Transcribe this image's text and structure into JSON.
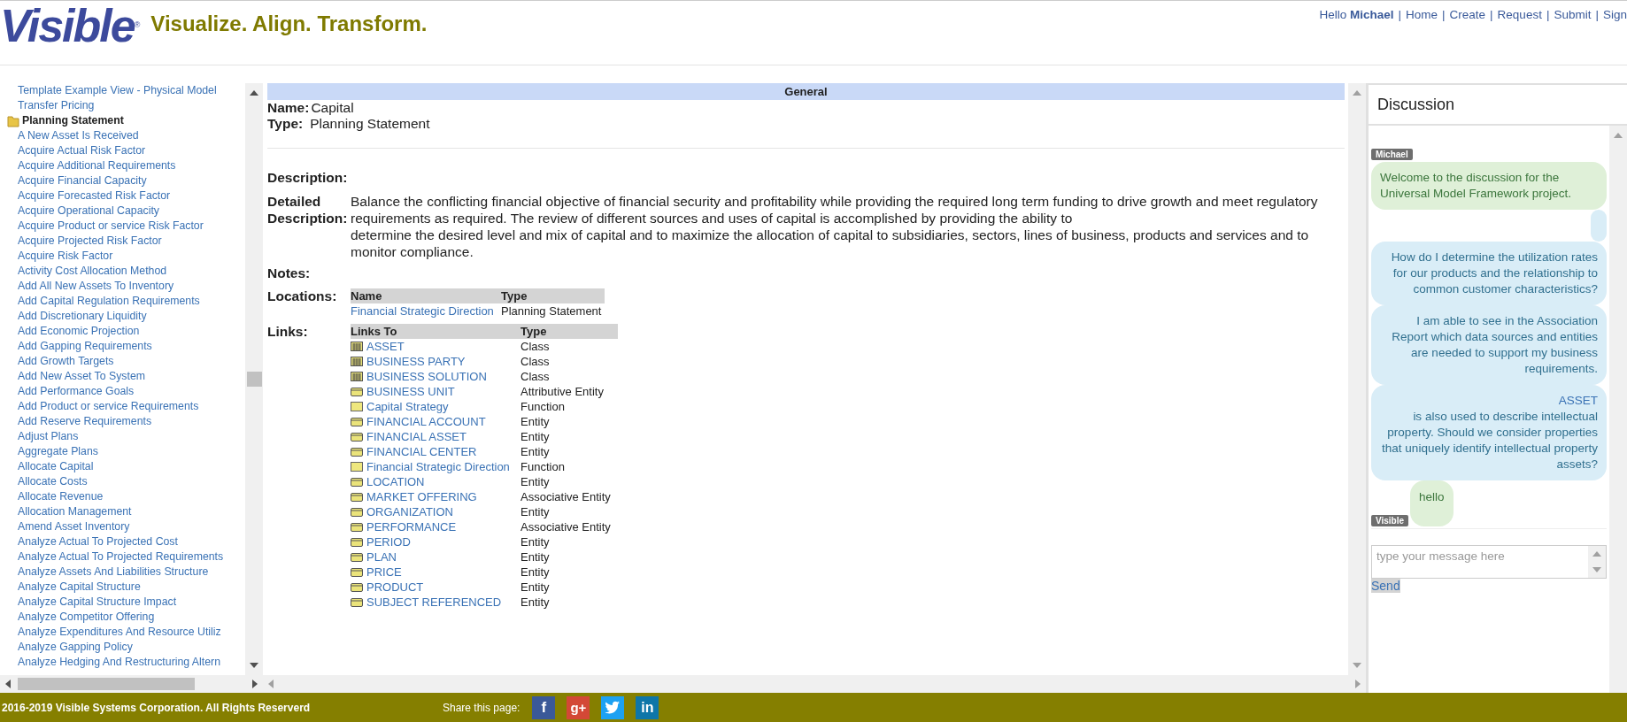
{
  "header": {
    "logo": "Visible",
    "logo_mark": "®",
    "tagline": "Visualize. Align. Transform.",
    "greeting": "Hello **Michael**",
    "separator": "|",
    "nav": [
      "Home",
      "Create",
      "Request",
      "Submit",
      "Sign"
    ]
  },
  "sidebar": {
    "items": [
      {
        "kind": "link",
        "label": "Template Example View - Physical Model"
      },
      {
        "kind": "link",
        "label": "Transfer Pricing"
      },
      {
        "kind": "folder",
        "label": "Planning Statement"
      },
      {
        "kind": "link",
        "label": "A New Asset Is Received"
      },
      {
        "kind": "link",
        "label": "Acquire Actual Risk Factor"
      },
      {
        "kind": "link",
        "label": "Acquire Additional Requirements"
      },
      {
        "kind": "link",
        "label": "Acquire Financial Capacity"
      },
      {
        "kind": "link",
        "label": "Acquire Forecasted Risk Factor"
      },
      {
        "kind": "link",
        "label": "Acquire Operational Capacity"
      },
      {
        "kind": "link",
        "label": "Acquire Product or service Risk Factor"
      },
      {
        "kind": "link",
        "label": "Acquire Projected Risk Factor"
      },
      {
        "kind": "link",
        "label": "Acquire Risk Factor"
      },
      {
        "kind": "link",
        "label": "Activity Cost Allocation Method"
      },
      {
        "kind": "link",
        "label": "Add All New Assets To Inventory"
      },
      {
        "kind": "link",
        "label": "Add Capital Regulation Requirements"
      },
      {
        "kind": "link",
        "label": "Add Discretionary Liquidity"
      },
      {
        "kind": "link",
        "label": "Add Economic Projection"
      },
      {
        "kind": "link",
        "label": "Add Gapping Requirements"
      },
      {
        "kind": "link",
        "label": "Add Growth Targets"
      },
      {
        "kind": "link",
        "label": "Add New Asset To System"
      },
      {
        "kind": "link",
        "label": "Add Performance Goals"
      },
      {
        "kind": "link",
        "label": "Add Product or service Requirements"
      },
      {
        "kind": "link",
        "label": "Add Reserve Requirements"
      },
      {
        "kind": "link",
        "label": "Adjust Plans"
      },
      {
        "kind": "link",
        "label": "Aggregate Plans"
      },
      {
        "kind": "link",
        "label": "Allocate Capital"
      },
      {
        "kind": "link",
        "label": "Allocate Costs"
      },
      {
        "kind": "link",
        "label": "Allocate Revenue"
      },
      {
        "kind": "link",
        "label": "Allocation Management"
      },
      {
        "kind": "link",
        "label": "Amend Asset Inventory"
      },
      {
        "kind": "link",
        "label": "Analyze Actual To Projected Cost"
      },
      {
        "kind": "link",
        "label": "Analyze Actual To Projected Requirements"
      },
      {
        "kind": "link",
        "label": "Analyze Assets And Liabilities Structure"
      },
      {
        "kind": "link",
        "label": "Analyze Capital Structure"
      },
      {
        "kind": "link",
        "label": "Analyze Capital Structure Impact"
      },
      {
        "kind": "link",
        "label": "Analyze Competitor Offering"
      },
      {
        "kind": "link",
        "label": "Analyze Expenditures And Resource Utiliz"
      },
      {
        "kind": "link",
        "label": "Analyze Gapping Policy"
      },
      {
        "kind": "link",
        "label": "Analyze Hedging And Restructuring Altern"
      }
    ]
  },
  "general": {
    "title": "General",
    "name_label": "Name:",
    "name": "Capital",
    "type_label": "Type:",
    "type": "Planning Statement",
    "description_label": "Description:",
    "detailed_label": "Detailed Description:",
    "detailed_lines": [
      "Balance the conflicting financial objective of financial security and profitability while providing the required long term funding to drive growth and meet regulatory requirements as required. The review of different sources and uses of capital is accomplished by providing the ability to",
      "determine the desired level and mix of capital and to maximize the allocation of capital to subsidiaries, sectors, lines of business, products and services and to monitor compliance."
    ],
    "notes_label": "Notes:",
    "locations_label": "Locations:",
    "locations_columns": [
      "Name",
      "Type"
    ],
    "locations": [
      {
        "name": "Financial Strategic Direction",
        "type": "Planning Statement"
      }
    ],
    "links_label": "Links:",
    "links_columns": [
      "Links To",
      "Type"
    ],
    "links": [
      {
        "kind": "class",
        "name": "ASSET",
        "type": "Class"
      },
      {
        "kind": "class",
        "name": "BUSINESS PARTY",
        "type": "Class"
      },
      {
        "kind": "class",
        "name": "BUSINESS SOLUTION",
        "type": "Class"
      },
      {
        "kind": "entity",
        "name": "BUSINESS UNIT",
        "type": "Attributive Entity"
      },
      {
        "kind": "function",
        "name": "Capital Strategy",
        "type": "Function"
      },
      {
        "kind": "entity",
        "name": "FINANCIAL ACCOUNT",
        "type": "Entity"
      },
      {
        "kind": "entity",
        "name": "FINANCIAL ASSET",
        "type": "Entity"
      },
      {
        "kind": "entity",
        "name": "FINANCIAL CENTER",
        "type": "Entity"
      },
      {
        "kind": "function",
        "name": "Financial Strategic Direction",
        "type": "Function"
      },
      {
        "kind": "entity",
        "name": "LOCATION",
        "type": "Entity"
      },
      {
        "kind": "entity",
        "name": "MARKET OFFERING",
        "type": "Associative Entity"
      },
      {
        "kind": "entity",
        "name": "ORGANIZATION",
        "type": "Entity"
      },
      {
        "kind": "entity",
        "name": "PERFORMANCE",
        "type": "Associative Entity"
      },
      {
        "kind": "entity",
        "name": "PERIOD",
        "type": "Entity"
      },
      {
        "kind": "entity",
        "name": "PLAN",
        "type": "Entity"
      },
      {
        "kind": "entity",
        "name": "PRICE",
        "type": "Entity"
      },
      {
        "kind": "entity",
        "name": "PRODUCT",
        "type": "Entity"
      },
      {
        "kind": "entity",
        "name": "SUBJECT REFERENCED",
        "type": "Entity"
      }
    ]
  },
  "discussion": {
    "title": "Discussion",
    "messages": [
      {
        "kind": "badge",
        "text": "Michael"
      },
      {
        "kind": "mine",
        "text": "Welcome to the discussion for the Universal Model Framework project."
      },
      {
        "kind": "empty"
      },
      {
        "kind": "theirs",
        "text": "How do I determine the utilization rates for our products and the relationship to common customer characteristics?"
      },
      {
        "kind": "theirs",
        "text": "I am able to see in the Association Report which data sources and entities are needed to support my business requirements."
      },
      {
        "kind": "theirs",
        "link": "ASSET",
        "text": "is also used to describe intellectual property. Should we consider properties that uniquely identify intellectual property assets?"
      },
      {
        "kind": "signed",
        "badge": "Visible",
        "text": "hello"
      }
    ],
    "placeholder": "type your message here",
    "send": "Send"
  },
  "footer": {
    "copyright": "2016-2019 Visible Systems Corporation. All Rights Reserverd",
    "share_label": "Share this page:",
    "social": [
      {
        "kind": "facebook",
        "glyph": "f"
      },
      {
        "kind": "google",
        "glyph": "g+"
      },
      {
        "kind": "twitter"
      },
      {
        "kind": "linkedin",
        "glyph": "in"
      }
    ]
  }
}
